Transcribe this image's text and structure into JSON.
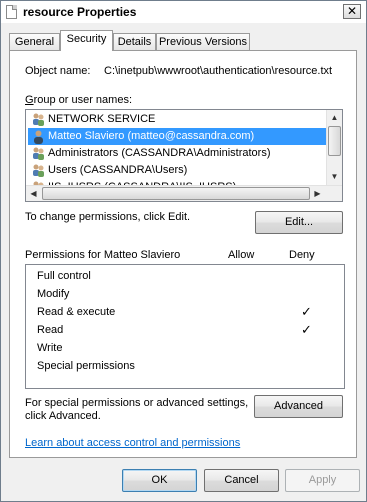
{
  "window": {
    "title": "resource Properties",
    "close_glyph": "✕"
  },
  "tabs": [
    {
      "label": "General"
    },
    {
      "label": "Security"
    },
    {
      "label": "Details"
    },
    {
      "label": "Previous Versions"
    }
  ],
  "security": {
    "object_name_label": "Object name:",
    "object_name_value": "C:\\inetpub\\wwwroot\\authentication\\resource.txt",
    "group_label": "Group or user names:",
    "groups": [
      {
        "label": "NETWORK SERVICE",
        "icon": "group-icon"
      },
      {
        "label": "Matteo Slaviero (matteo@cassandra.com)",
        "icon": "user-icon"
      },
      {
        "label": "Administrators (CASSANDRA\\Administrators)",
        "icon": "group-icon"
      },
      {
        "label": "Users (CASSANDRA\\Users)",
        "icon": "group-icon"
      },
      {
        "label": "IIS_IUSRS (CASSANDRA\\IIS_IUSRS)",
        "icon": "group-icon"
      }
    ],
    "change_text": "To change permissions, click Edit.",
    "edit_button": "Edit...",
    "permissions_for": "Permissions for Matteo Slaviero",
    "allow_header": "Allow",
    "deny_header": "Deny",
    "permissions": [
      {
        "name": "Full control",
        "allow": "",
        "deny": ""
      },
      {
        "name": "Modify",
        "allow": "",
        "deny": ""
      },
      {
        "name": "Read & execute",
        "allow": "",
        "deny": "✓"
      },
      {
        "name": "Read",
        "allow": "",
        "deny": "✓"
      },
      {
        "name": "Write",
        "allow": "",
        "deny": ""
      },
      {
        "name": "Special permissions",
        "allow": "",
        "deny": ""
      }
    ],
    "advanced_text_1": "For special permissions or advanced settings,",
    "advanced_text_2": "click Advanced.",
    "advanced_button": "Advanced",
    "learn_link": "Learn about access control and permissions"
  },
  "footer": {
    "ok": "OK",
    "cancel": "Cancel",
    "apply": "Apply"
  },
  "colors": {
    "selection": "#3399ff",
    "link": "#0066cc"
  }
}
